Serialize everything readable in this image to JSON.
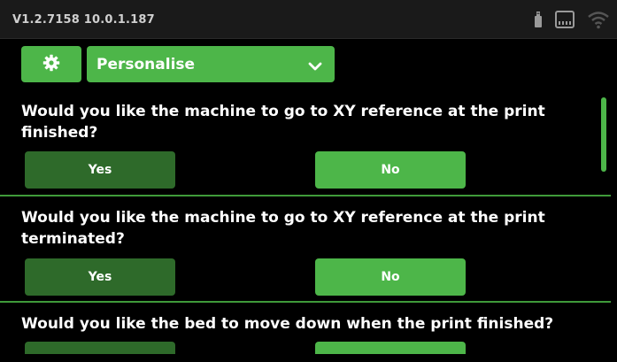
{
  "status_bar": {
    "version": "V1.2.7158  10.0.1.187",
    "icons": [
      "usb-icon",
      "sd-card-icon",
      "wifi-icon"
    ]
  },
  "toolbar": {
    "settings_icon": "gear-icon",
    "dropdown_label": "Personalise",
    "dropdown_icon": "chevron-down-icon"
  },
  "questions": [
    {
      "text": "Would you like the machine to go to XY reference at the print finished?",
      "yes_label": "Yes",
      "no_label": "No"
    },
    {
      "text": "Would you like the machine to go to XY reference at the print terminated?",
      "yes_label": "Yes",
      "no_label": "No"
    },
    {
      "text": "Would you like the bed to move down when the print finished?",
      "yes_label": "",
      "no_label": ""
    }
  ],
  "colors": {
    "accent": "#4db649",
    "accent_dark": "#2e6a2a",
    "background": "#000000",
    "status_bar": "#1a1a1a"
  }
}
